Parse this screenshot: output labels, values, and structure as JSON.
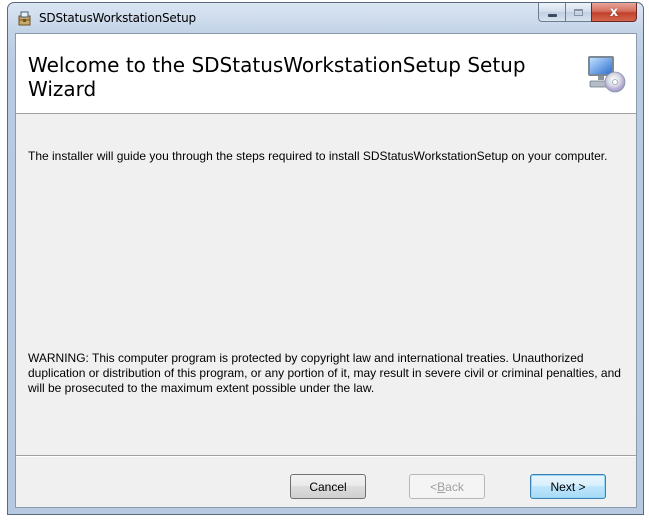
{
  "window": {
    "title": "SDStatusWorkstationSetup",
    "close_glyph": "x"
  },
  "icons": {
    "app": "installer-package-icon",
    "banner": "computer-with-disc-icon"
  },
  "banner": {
    "title": "Welcome to the SDStatusWorkstationSetup Setup Wizard"
  },
  "body": {
    "intro": "The installer will guide you through the steps required to install SDStatusWorkstationSetup on your computer.",
    "warning": "WARNING: This computer program is protected by copyright law and international treaties. Unauthorized duplication or distribution of this program, or any portion of it, may result in severe civil or criminal penalties, and will be prosecuted to the maximum extent possible under the law."
  },
  "buttons": {
    "cancel": "Cancel",
    "back_prefix": "< ",
    "back_accel": "B",
    "back_rest": "ack",
    "next": "Next >"
  },
  "colors": {
    "client_bg": "#f0f0f0",
    "banner_bg": "#ffffff",
    "close_red": "#c0412c",
    "default_button_border": "#3c7fb1"
  }
}
